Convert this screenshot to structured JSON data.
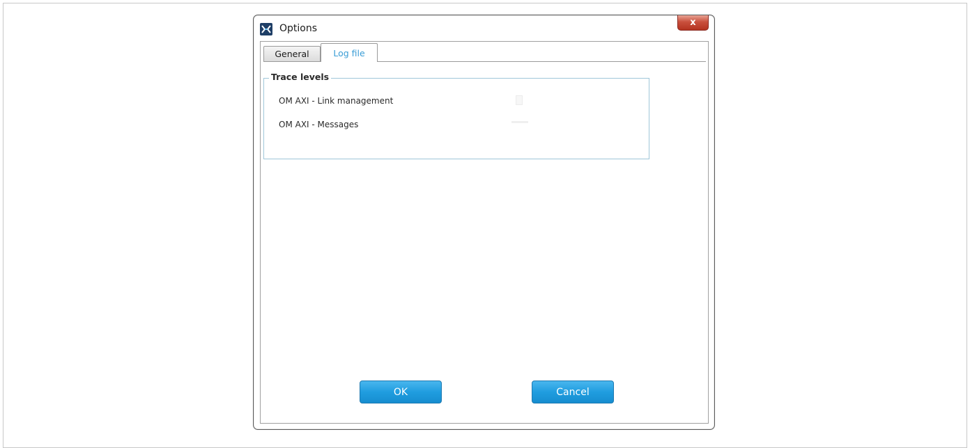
{
  "window": {
    "title": "Options",
    "close_label": "x"
  },
  "tabs": [
    {
      "label": "General",
      "active": false
    },
    {
      "label": "Log file",
      "active": true
    }
  ],
  "trace_levels": {
    "group_title": "Trace levels",
    "items": [
      {
        "label": "OM AXI - Link management"
      },
      {
        "label": "OM AXI - Messages"
      }
    ]
  },
  "buttons": {
    "ok_label": "OK",
    "cancel_label": "Cancel"
  },
  "colors": {
    "accent": "#209ddf",
    "active_tab_text": "#3a9dd6",
    "close_button": "#c9503d"
  },
  "icons": {
    "app": "options-app-icon",
    "close": "close-icon"
  }
}
